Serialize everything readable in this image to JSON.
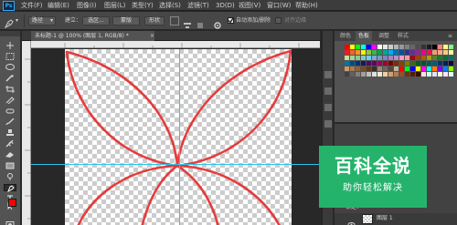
{
  "app": {
    "logo_text": "Ps"
  },
  "menu": [
    "文件(F)",
    "编辑(E)",
    "图像(I)",
    "图层(L)",
    "类型(Y)",
    "选择(S)",
    "滤镜(T)",
    "3D(D)",
    "视图(V)",
    "窗口(W)",
    "帮助(H)"
  ],
  "options": {
    "mode_value": "路径",
    "make_label": "建立：",
    "selection_btn": "选区...",
    "mask_btn": "蒙版",
    "shape_btn": "形状",
    "auto_add_delete_label": "自动添加/删除",
    "auto_add_delete_checked": true,
    "align_edges_label": "对齐边缘"
  },
  "document": {
    "tab_title": "未标题-1 @ 100% (图层 1, RGB/8) *"
  },
  "panels": {
    "tabs": [
      "颜色",
      "色板",
      "调整",
      "样式"
    ],
    "active_tab": "色板",
    "lock_label": "锁定：",
    "layer_name": "图层 1"
  },
  "watermark": {
    "title": "百科全说",
    "subtitle": "助你轻松解决"
  },
  "colors": {
    "foreground": "#ff0000",
    "background": "#ffffff",
    "path_stroke": "#e52b2b",
    "guide": "#2ec5e8",
    "watermark": "#25b36c"
  },
  "swatches": [
    [
      "#ff0000",
      "#ffff00",
      "#00ff00",
      "#00ffff",
      "#0000ff",
      "#ff00ff",
      "#ffffff",
      "#e6e6e6",
      "#cccccc",
      "#b3b3b3",
      "#999999",
      "#808080",
      "#666666",
      "#4d4d4d",
      "#333333",
      "#1a1a1a",
      "#000000",
      "#ff8080",
      "#ffff80",
      "#80ff80"
    ],
    [
      "#ed1c24",
      "#f26522",
      "#f7941d",
      "#fff200",
      "#8dc63f",
      "#39b54a",
      "#00a651",
      "#00a99d",
      "#00aeef",
      "#0072bc",
      "#0054a6",
      "#2e3192",
      "#662d91",
      "#92278f",
      "#ec008c",
      "#ed145b",
      "#f7977a",
      "#fbad82",
      "#fdc689",
      "#fff799"
    ],
    [
      "#c4df9b",
      "#a3d39c",
      "#82ca9c",
      "#7accc8",
      "#6dcff6",
      "#7da7d9",
      "#8393ca",
      "#8781bd",
      "#a186be",
      "#bd8cbf",
      "#f49ac1",
      "#f6989d",
      "#9e0b0f",
      "#a0410d",
      "#a36209",
      "#aba000",
      "#598527",
      "#1a7b30",
      "#007236",
      "#00746b"
    ],
    [
      "#0076a3",
      "#004b80",
      "#003471",
      "#1b1464",
      "#440e62",
      "#630460",
      "#9e005d",
      "#9e0039",
      "#790000",
      "#7b2e00",
      "#7d4900",
      "#827b00",
      "#406618",
      "#005e20",
      "#005826",
      "#005952",
      "#005b7f",
      "#003663",
      "#002157",
      "#0d004c"
    ],
    [
      "#c69c6d",
      "#a67c52",
      "#8c6239",
      "#754c24",
      "#603913",
      "#362f2d",
      "#998675",
      "#736357",
      "#534741",
      "#c7b299",
      "#ff0000",
      "#00ff00",
      "#0000ff",
      "#ffff00",
      "#ff00ff",
      "#00ffff",
      "#ff8000",
      "#8000ff",
      "#0080ff",
      "#80ff00"
    ],
    [
      "#404040",
      "#606060",
      "#808080",
      "#a0a0a0",
      "#c0c0c0",
      "#e0e0e0",
      "#f5e8d0",
      "#f0d0a0",
      "#d0a070",
      "#b08050",
      "#905030",
      "#703010",
      "#502000",
      "#301000",
      "#ffe0e0",
      "#e0ffe0",
      "#e0e0ff",
      "#ffffe0",
      "#ffe0ff",
      "#e0ffff"
    ]
  ]
}
